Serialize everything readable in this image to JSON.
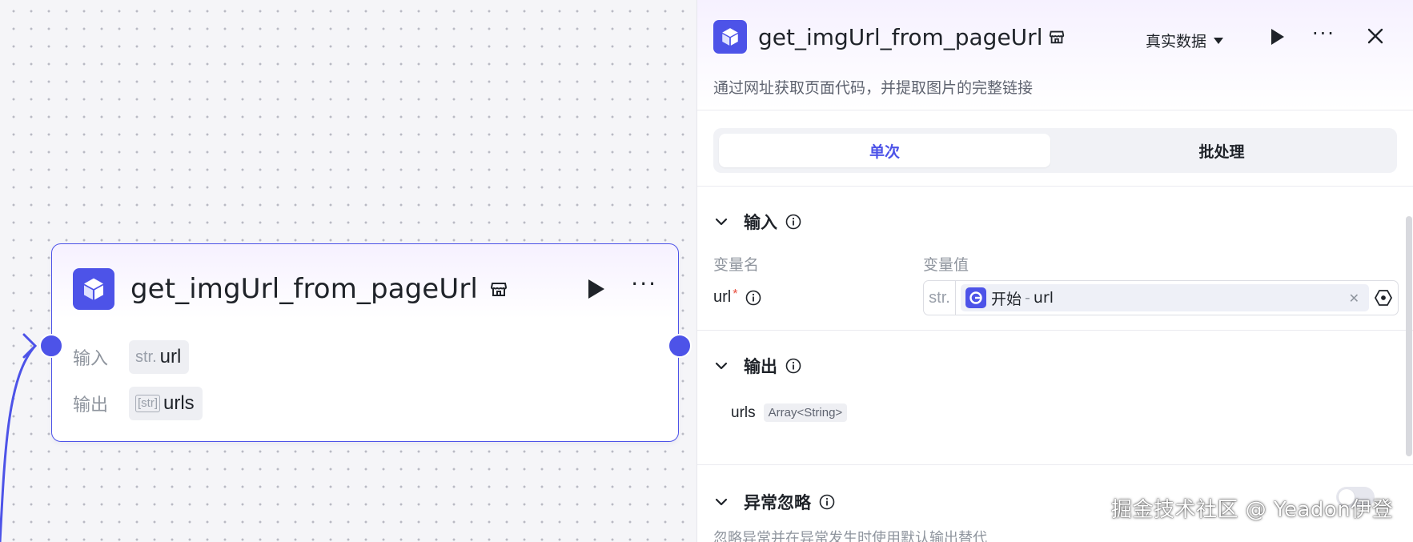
{
  "node": {
    "title": "get_imgUrl_from_pageUrl",
    "icon": "cube-icon",
    "input_label": "输入",
    "input_type": "str.",
    "input_name": "url",
    "output_label": "输出",
    "output_type": "[str]",
    "output_name": "urls"
  },
  "panel": {
    "title": "get_imgUrl_from_pageUrl",
    "mode": "真实数据",
    "description": "通过网址获取页面代码，并提取图片的完整链接",
    "tabs": [
      "单次",
      "批处理"
    ],
    "input_section": {
      "title": "输入",
      "col_name": "变量名",
      "col_value": "变量值",
      "var_name": "url",
      "required_mark": "*",
      "value_type": "str.",
      "ref_source": "开始",
      "ref_sep": "-",
      "ref_var": "url"
    },
    "output_section": {
      "title": "输出",
      "name": "urls",
      "type": "Array<String>"
    },
    "ignore_section": {
      "title": "异常忽略",
      "description": "忽略异常并在异常发生时使用默认输出替代",
      "enabled": false
    }
  },
  "watermark": "掘金技术社区 @ Yeadon伊登",
  "colors": {
    "accent": "#4d53e8",
    "canvas": "#f5f5f8",
    "text": "#1f2329",
    "muted": "#8f959e"
  }
}
